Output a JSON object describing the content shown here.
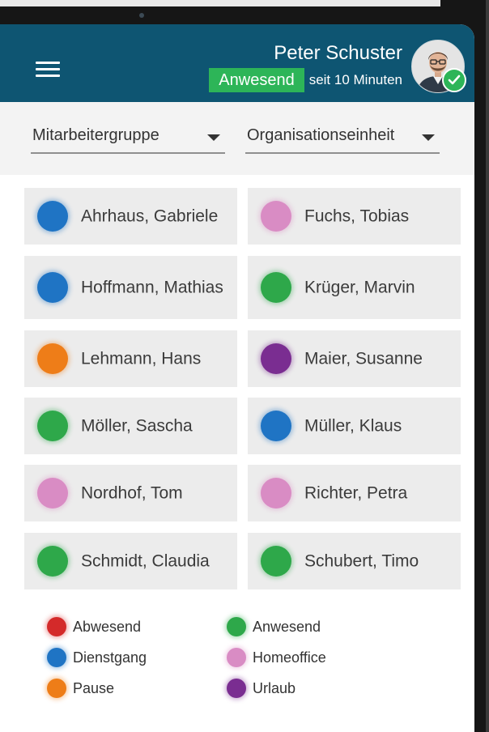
{
  "header": {
    "user_name": "Peter Schuster",
    "status_label": "Anwesend",
    "status_since": "seit 10 Minuten",
    "status_color": "#2db558",
    "background_color": "#0e5572"
  },
  "filters": {
    "group_label": "Mitarbeitergruppe",
    "org_label": "Organisationseinheit"
  },
  "employees": [
    {
      "name": "Ahrhaus, Gabriele",
      "status": "Dienstgang"
    },
    {
      "name": "Fuchs, Tobias",
      "status": "Homeoffice"
    },
    {
      "name": "Hoffmann, Mathias",
      "status": "Dienstgang"
    },
    {
      "name": "Krüger, Marvin",
      "status": "Anwesend"
    },
    {
      "name": "Lehmann, Hans",
      "status": "Pause"
    },
    {
      "name": "Maier, Susanne",
      "status": "Urlaub"
    },
    {
      "name": "Möller, Sascha",
      "status": "Anwesend"
    },
    {
      "name": "Müller, Klaus",
      "status": "Dienstgang"
    },
    {
      "name": "Nordhof, Tom",
      "status": "Homeoffice"
    },
    {
      "name": "Richter, Petra",
      "status": "Homeoffice"
    },
    {
      "name": "Schmidt, Claudia",
      "status": "Anwesend"
    },
    {
      "name": "Schubert, Timo",
      "status": "Anwesend"
    }
  ],
  "legend": [
    {
      "label": "Abwesend",
      "color": "#d42a2a"
    },
    {
      "label": "Anwesend",
      "color": "#2ea84a"
    },
    {
      "label": "Dienstgang",
      "color": "#1f74c4"
    },
    {
      "label": "Homeoffice",
      "color": "#d98cc4"
    },
    {
      "label": "Pause",
      "color": "#ee7d18"
    },
    {
      "label": "Urlaub",
      "color": "#7a2d91"
    }
  ]
}
